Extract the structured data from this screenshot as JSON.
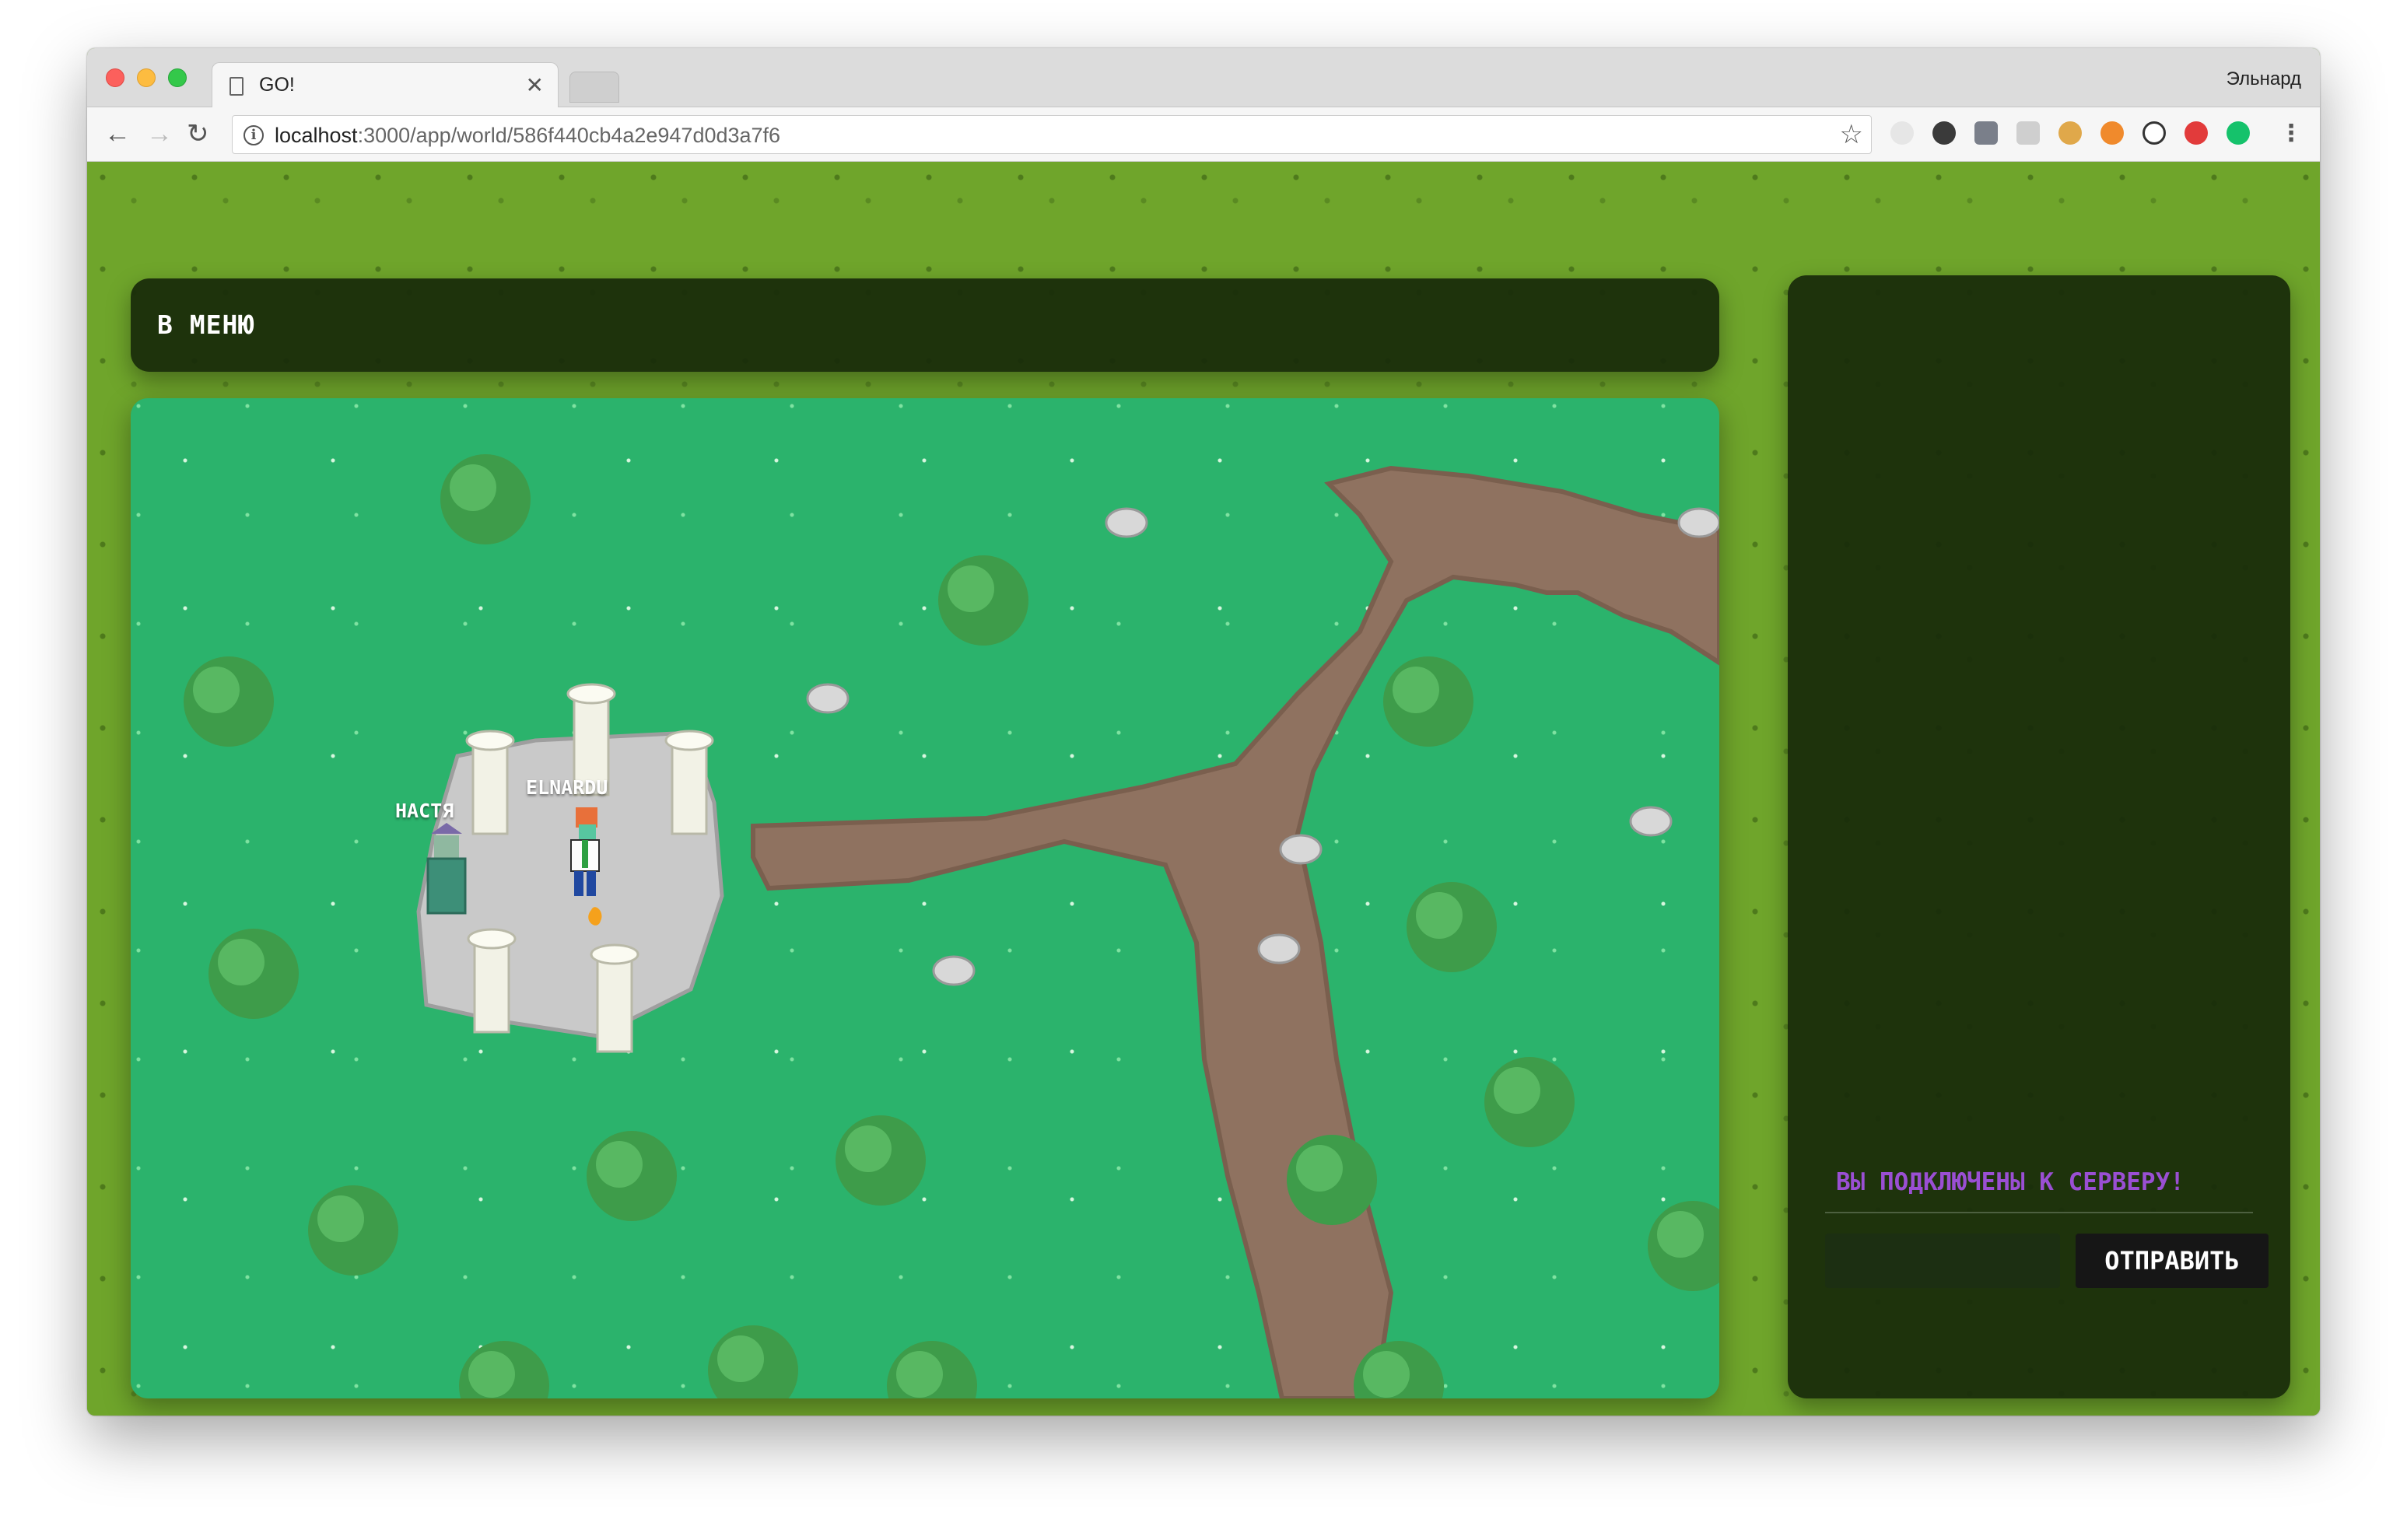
{
  "browser": {
    "tab_title": "GO!",
    "profile_name": "Эльнард",
    "url_host": "localhost",
    "url_rest": ":3000/app/world/586f440cb4a2e947d0d3a7f6"
  },
  "menu": {
    "label": "В МЕНЮ"
  },
  "players": [
    {
      "name": "НАСТЯ"
    },
    {
      "name": "ELNARDU"
    }
  ],
  "chat": {
    "status_message": "ВЫ ПОДКЛЮЧЕНЫ К СЕРВЕРУ!",
    "input_value": "",
    "input_placeholder": "",
    "send_label": "ОТПРАВИТЬ"
  },
  "colors": {
    "grass": "#2bb36c",
    "page_bg": "#6fa52b",
    "panel_bg": "#182a0a",
    "path": "#8f7260",
    "chat_status": "#9a4fd3"
  },
  "icons": [
    "page-icon",
    "info-icon",
    "star-icon",
    "back-icon",
    "forward-icon",
    "reload-icon",
    "more-icon"
  ]
}
